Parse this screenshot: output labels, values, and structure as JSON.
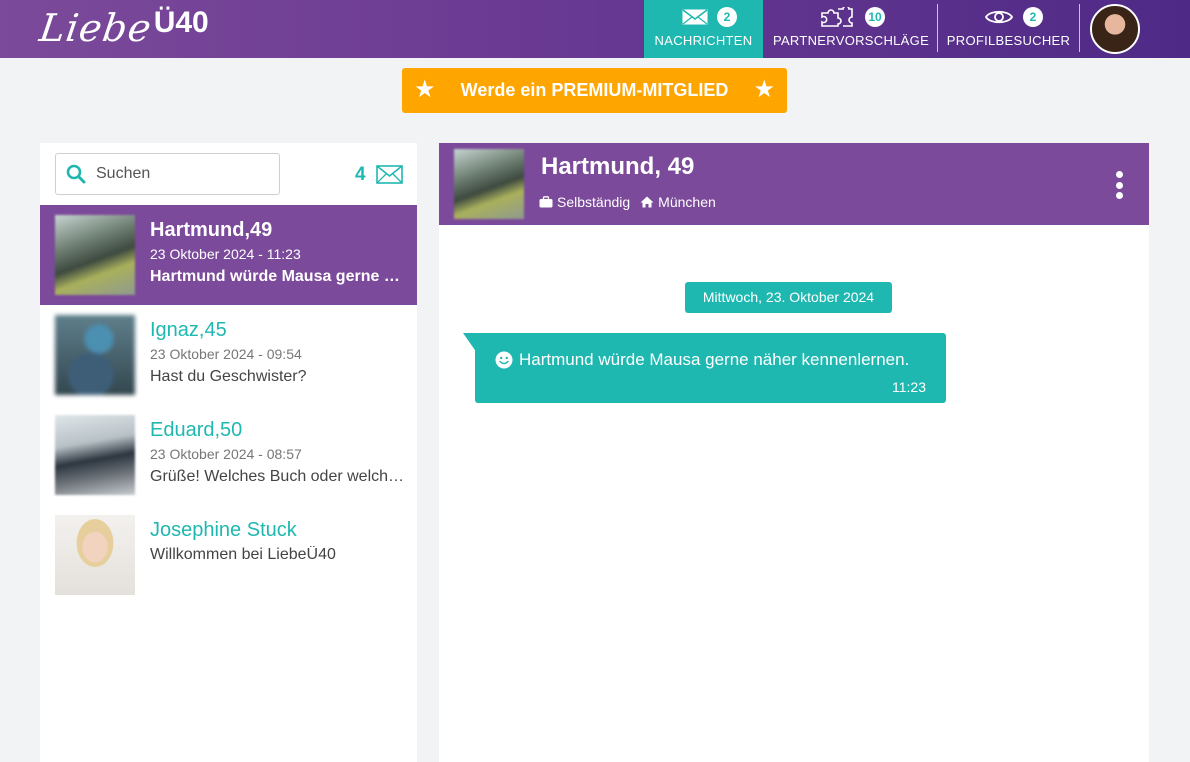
{
  "brand": {
    "logo_script": "Liebe",
    "logo_suffix": "Ü40"
  },
  "nav": {
    "messages": {
      "label": "NACHRICHTEN",
      "badge": "2"
    },
    "suggestions": {
      "label": "PARTNERVORSCHLÄGE",
      "badge": "10"
    },
    "visitors": {
      "label": "PROFILBESUCHER",
      "badge": "2"
    }
  },
  "premium": {
    "label": "Werde ein PREMIUM-MITGLIED"
  },
  "sidebar": {
    "search_placeholder": "Suchen",
    "message_count": "4",
    "conversations": [
      {
        "name": "Hartmund,49",
        "date": "23 Oktober 2024 - 11:23",
        "preview": "Hartmund würde Mausa gerne näher kennenlernen.",
        "active": true
      },
      {
        "name": "Ignaz,45",
        "date": "23 Oktober 2024 - 09:54",
        "preview": "Hast du Geschwister?",
        "active": false
      },
      {
        "name": "Eduard,50",
        "date": "23 Oktober 2024 - 08:57",
        "preview": "Grüße! Welches Buch oder welchen Film hast du zuletzt genossen?",
        "active": false
      },
      {
        "name": "Josephine Stuck",
        "date": "",
        "preview": "Willkommen bei LiebeÜ40",
        "active": false
      }
    ]
  },
  "chat": {
    "title": "Hartmund, 49",
    "occupation": "Selbständig",
    "city": "München",
    "date_divider": "Mittwoch, 23. Oktober 2024",
    "messages": [
      {
        "text": "Hartmund würde Mausa gerne näher kennenlernen.",
        "time": "11:23"
      }
    ]
  },
  "colors": {
    "primary": "#7b4a9a",
    "accent": "#1fb8b0",
    "premium": "#ffa500"
  },
  "icons": [
    "envelope-icon",
    "puzzle-icon",
    "eye-icon",
    "star-icon",
    "search-icon",
    "briefcase-icon",
    "home-icon",
    "kebab-menu-icon",
    "smiley-icon"
  ]
}
